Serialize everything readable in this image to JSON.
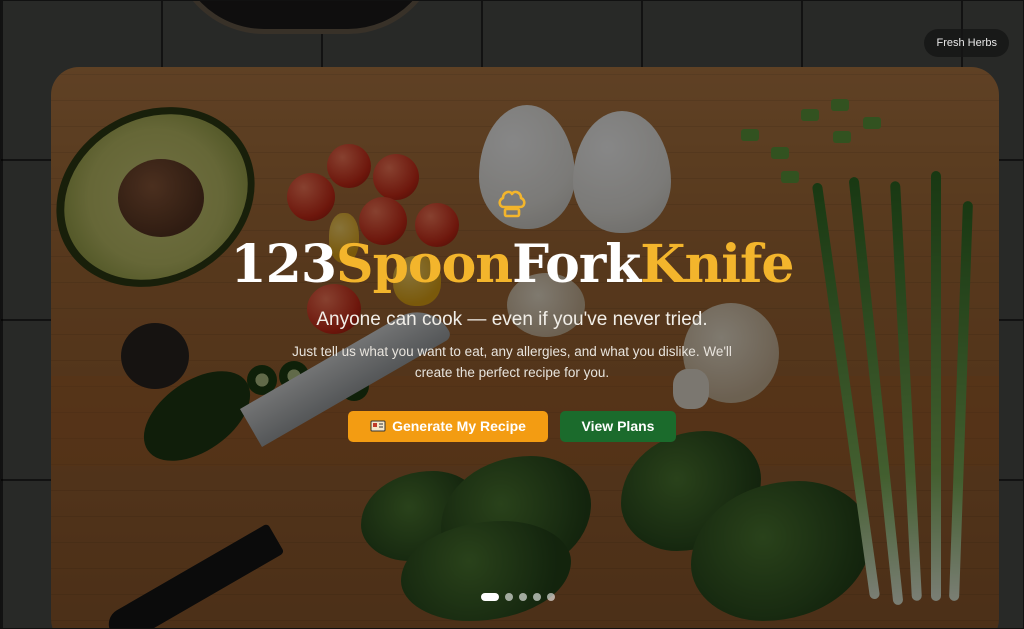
{
  "badge": {
    "label": "Fresh Herbs"
  },
  "hero": {
    "brand_parts": [
      "123",
      "Spoon",
      "Fork",
      "Knife"
    ],
    "tagline": "Anyone can cook — even if you've never tried.",
    "description": "Just tell us what you want to eat, any allergies, and what you dislike. We'll create the perfect recipe for you."
  },
  "actions": {
    "primary_label": "Generate My Recipe",
    "secondary_label": "View Plans"
  },
  "carousel": {
    "slide_count": 5,
    "active_index": 0
  },
  "colors": {
    "accent": "#f39c12",
    "brand_yellow": "#f3b52c",
    "secondary": "#1b6b2c"
  },
  "icons": {
    "hero": "chef-hat-icon",
    "primary_button": "recipe-icon"
  }
}
